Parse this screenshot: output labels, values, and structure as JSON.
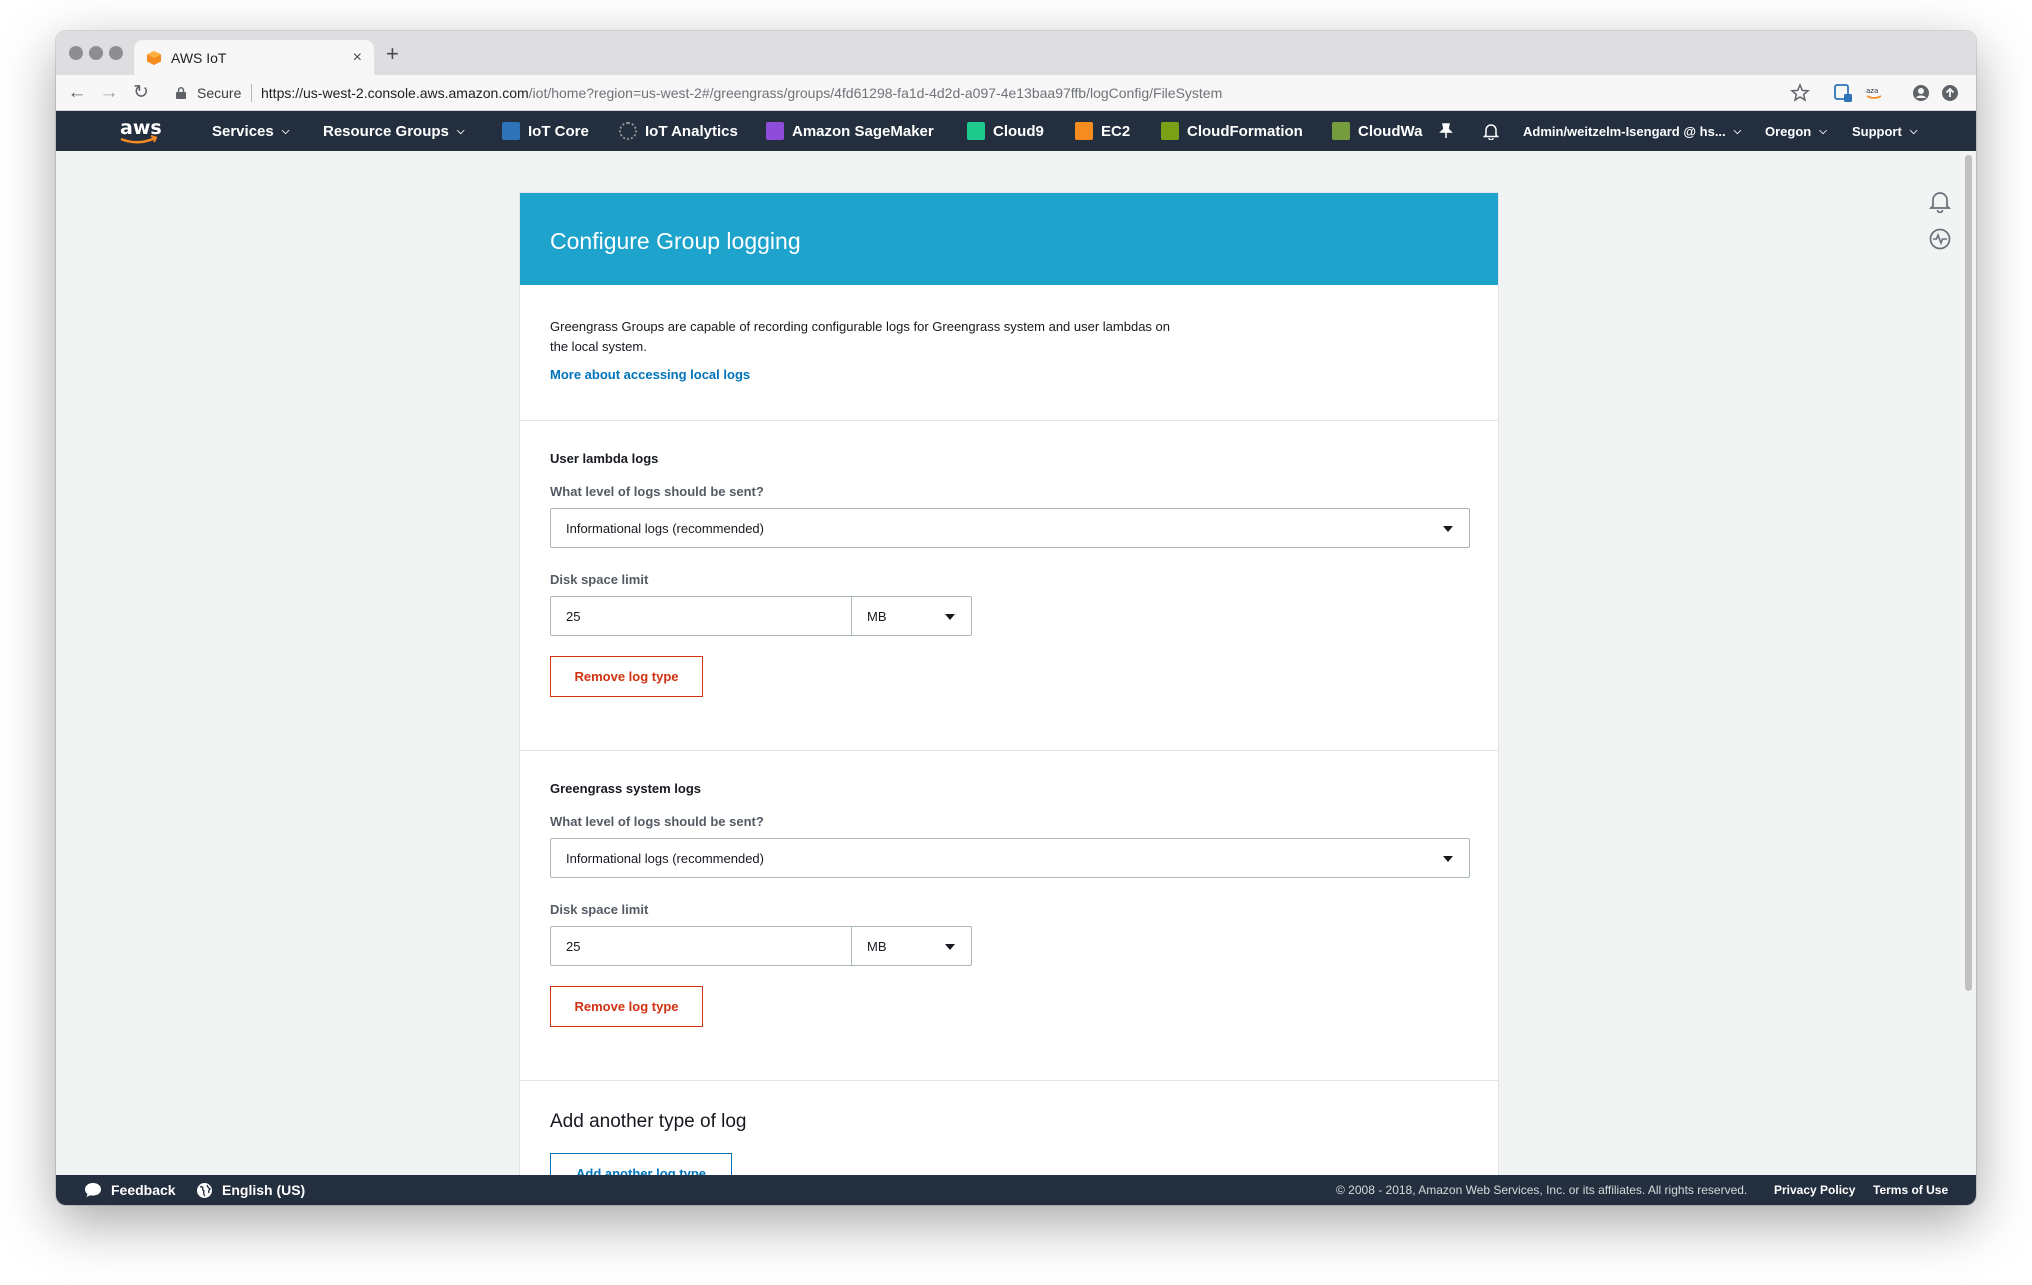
{
  "browser": {
    "tab_title": "AWS IoT",
    "secure_label": "Secure",
    "url_host": "https://us-west-2.console.aws.amazon.com",
    "url_path": "/iot/home?region=us-west-2#/greengrass/groups/4fd61298-fa1d-4d2d-a097-4e13baa97ffb/logConfig/FileSystem",
    "tab_close": "×",
    "new_tab": "+"
  },
  "nav": {
    "logo_text": "aws",
    "services": "Services",
    "resource_groups": "Resource Groups",
    "iot_core": "IoT Core",
    "iot_analytics": "IoT Analytics",
    "sagemaker": "Amazon SageMaker",
    "cloud9": "Cloud9",
    "ec2": "EC2",
    "cloudformation": "CloudFormation",
    "cloudwatch": "CloudWa",
    "account": "Admin/weitzelm-Isengard @ hs...",
    "region": "Oregon",
    "support": "Support",
    "colors": {
      "bar": "#232f3e",
      "iot_core": "#2e73b8",
      "analytics": "#8c8f94",
      "sagemaker": "#8f4bd9",
      "cloud9": "#1ec98e",
      "ec2": "#f68b1f",
      "cloudformation": "#7aa116",
      "cloudwatch": "#759c3e"
    }
  },
  "panel": {
    "title": "Configure Group logging",
    "intro_text": "Greengrass Groups are capable of recording configurable logs for Greengrass system and user lambdas on the local system.",
    "more_link": "More about accessing local logs",
    "sections": [
      {
        "title": "User lambda logs",
        "level_label": "What level of logs should be sent?",
        "level_value": "Informational logs (recommended)",
        "disk_label": "Disk space limit",
        "disk_value": "25",
        "disk_unit": "MB",
        "remove_label": "Remove log type"
      },
      {
        "title": "Greengrass system logs",
        "level_label": "What level of logs should be sent?",
        "level_value": "Informational logs (recommended)",
        "disk_label": "Disk space limit",
        "disk_value": "25",
        "disk_unit": "MB",
        "remove_label": "Remove log type"
      }
    ],
    "add_title": "Add another type of log",
    "add_button": "Add another log type",
    "header_color": "#1ea3cc"
  },
  "footer": {
    "feedback": "Feedback",
    "language": "English (US)",
    "copyright": "© 2008 - 2018, Amazon Web Services, Inc. or its affiliates. All rights reserved.",
    "privacy": "Privacy Policy",
    "terms": "Terms of Use"
  }
}
